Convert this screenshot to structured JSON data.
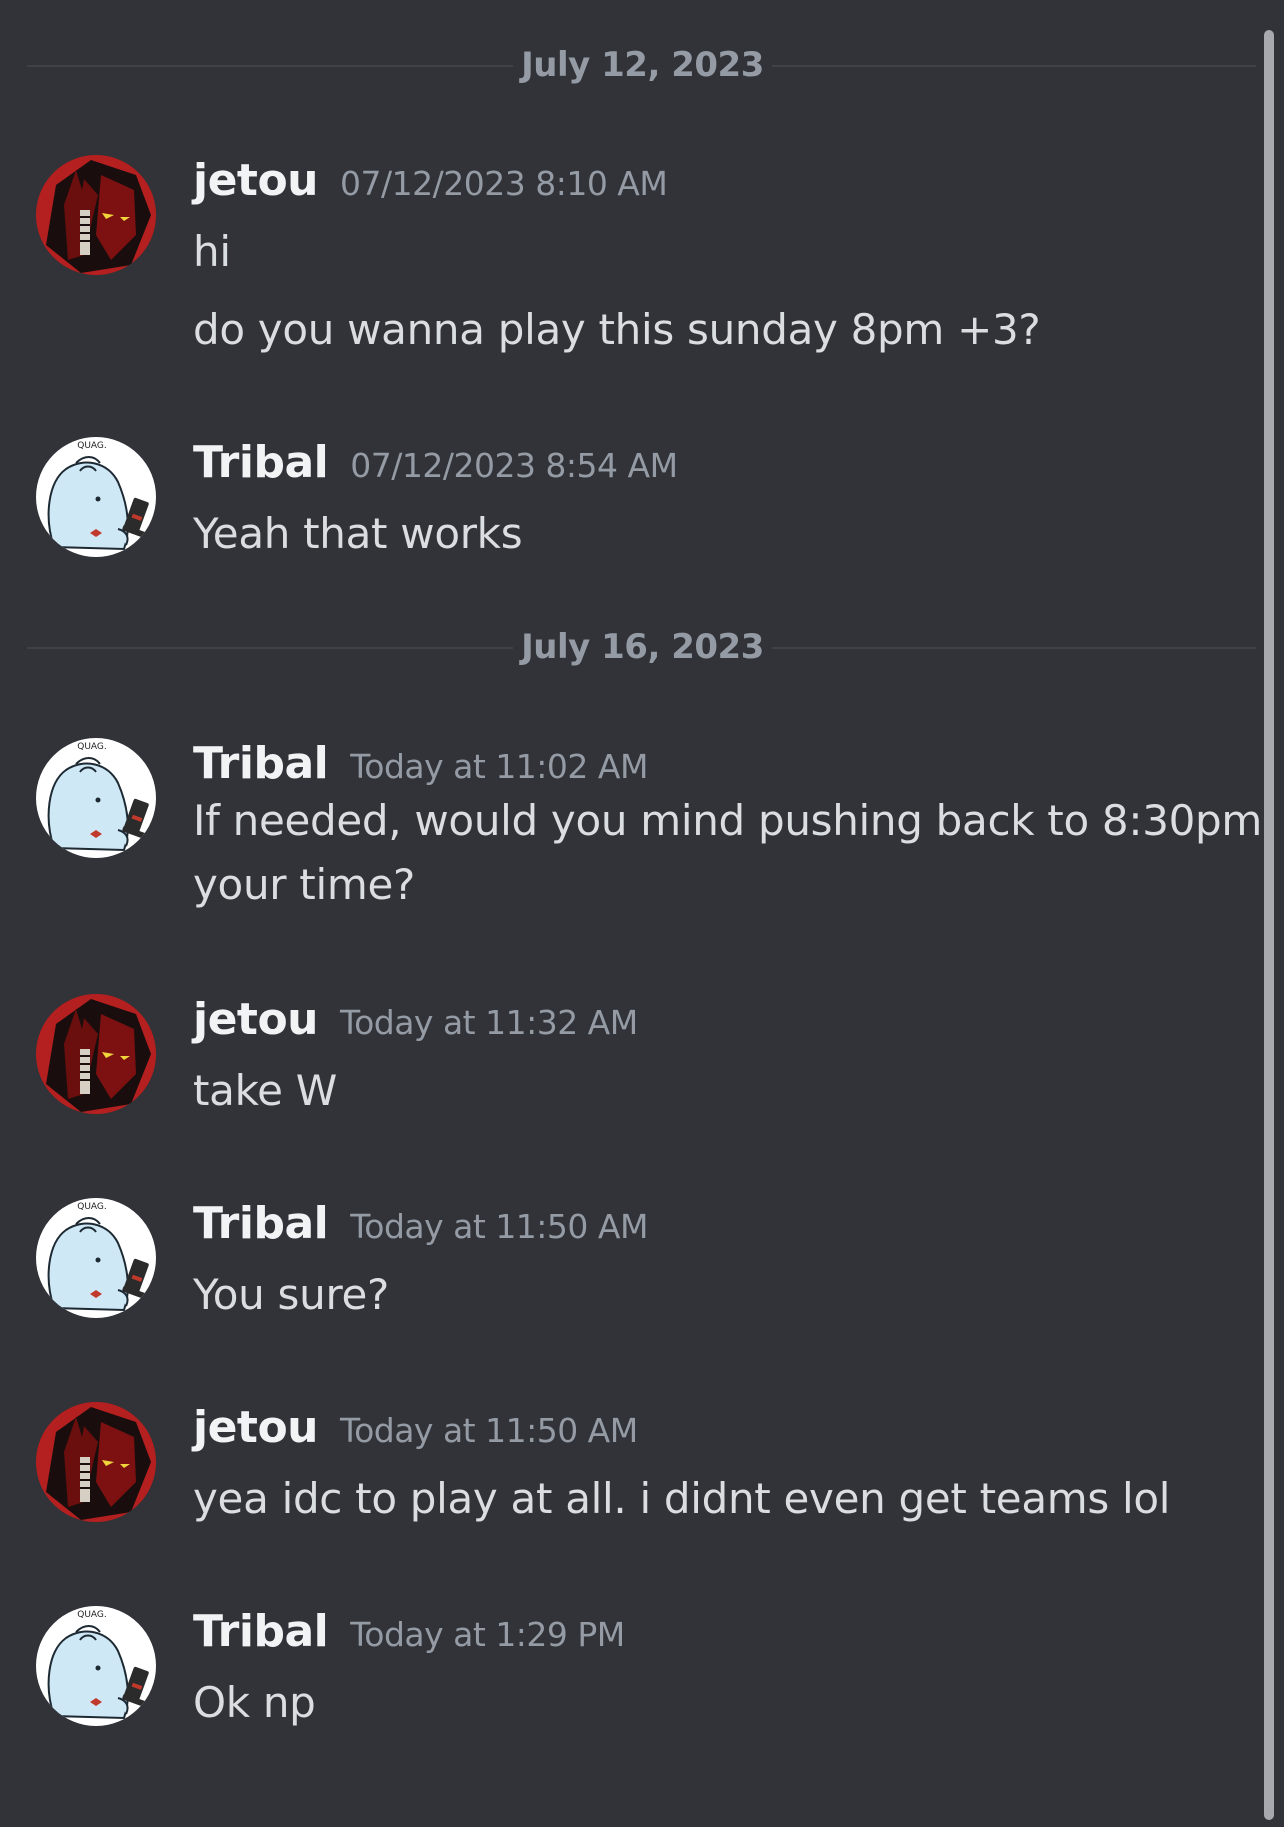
{
  "dividers": [
    {
      "date": "July 12, 2023"
    },
    {
      "date": "July 16, 2023"
    }
  ],
  "messages": [
    {
      "author": "jetou",
      "timestamp": "07/12/2023 8:10 AM",
      "avatar": "red-demon-avatar",
      "lines": [
        "hi",
        "do you wanna play this sunday 8pm +3?"
      ]
    },
    {
      "author": "Tribal",
      "timestamp": "07/12/2023 8:54 AM",
      "avatar": "blue-creature-avatar",
      "lines": [
        "Yeah that works"
      ]
    },
    {
      "author": "Tribal",
      "timestamp": "Today at 11:02 AM",
      "avatar": "blue-creature-avatar",
      "lines": [
        "If needed, would you mind pushing back to 8:30pm",
        "your time?"
      ]
    },
    {
      "author": "jetou",
      "timestamp": "Today at 11:32 AM",
      "avatar": "red-demon-avatar",
      "lines": [
        "take W"
      ]
    },
    {
      "author": "Tribal",
      "timestamp": "Today at 11:50 AM",
      "avatar": "blue-creature-avatar",
      "lines": [
        "You sure?"
      ]
    },
    {
      "author": "jetou",
      "timestamp": "Today at 11:50 AM",
      "avatar": "red-demon-avatar",
      "lines": [
        "yea idc to play at all. i didnt even get teams lol"
      ]
    },
    {
      "author": "Tribal",
      "timestamp": "Today at 1:29 PM",
      "avatar": "blue-creature-avatar",
      "lines": [
        "Ok np"
      ]
    }
  ],
  "avatar_text": {
    "tribal_logo": "QUAG."
  },
  "colors": {
    "background": "#313338",
    "username": "#f2f3f5",
    "timestamp": "#949ba4",
    "message_text": "#dbdee1",
    "divider_line": "#3f4147"
  }
}
